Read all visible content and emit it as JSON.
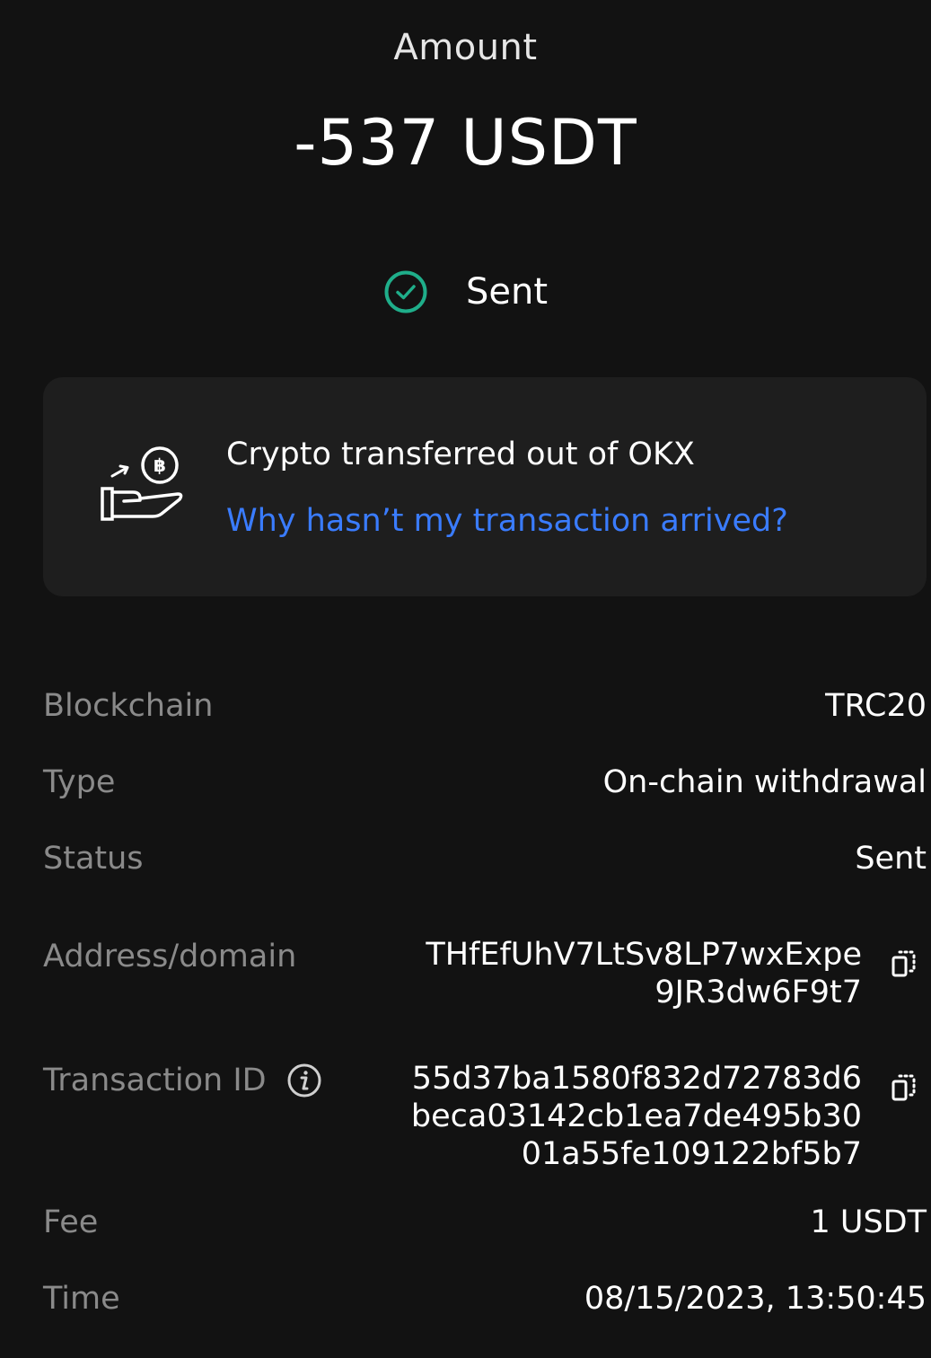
{
  "header": {
    "amount_label": "Amount",
    "amount_value": "-537 USDT",
    "status": "Sent"
  },
  "card": {
    "title": "Crypto transferred out of OKX",
    "link": "Why hasn’t my transaction arrived?",
    "icon": "hand-coin-icon"
  },
  "details": {
    "blockchain": {
      "label": "Blockchain",
      "value": "TRC20"
    },
    "type": {
      "label": "Type",
      "value": "On-chain withdrawal"
    },
    "status": {
      "label": "Status",
      "value": "Sent"
    },
    "address": {
      "label": "Address/domain",
      "lines": [
        "THfEfUhV7LtSv8LP7wxExpe",
        "9JR3dw6F9t7"
      ]
    },
    "txid": {
      "label": "Transaction ID",
      "lines": [
        "55d37ba1580f832d72783d6",
        "beca03142cb1ea7de495b30",
        "01a55fe109122bf5b7"
      ]
    },
    "fee": {
      "label": "Fee",
      "value": "1 USDT"
    },
    "time": {
      "label": "Time",
      "value": "08/15/2023, 13:50:45"
    }
  },
  "colors": {
    "background": "#121212",
    "card": "#1e1e1e",
    "success": "#1fae8a",
    "link": "#3a7cff",
    "label": "#8a8a8a"
  }
}
